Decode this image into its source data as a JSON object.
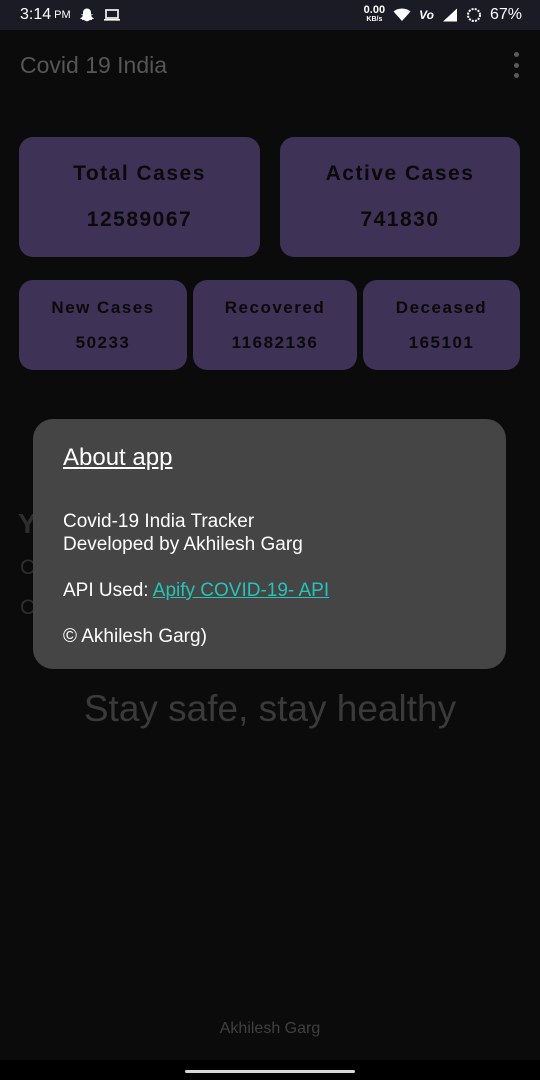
{
  "status_bar": {
    "time": "3:14",
    "ampm": "PM",
    "speed_value": "0.00",
    "speed_unit": "KB/s",
    "network_label": "Vo",
    "battery": "67%",
    "icons": [
      "snapchat-icon",
      "laptop-icon",
      "wifi-icon",
      "signal-icon",
      "battery-icon"
    ]
  },
  "app_bar": {
    "title": "Covid 19 India"
  },
  "stats": {
    "total": {
      "label": "Total Cases",
      "value": "12589067"
    },
    "active": {
      "label": "Active Cases",
      "value": "741830"
    },
    "new": {
      "label": "New Cases",
      "value": "50233"
    },
    "recovered": {
      "label": "Recovered",
      "value": "11682136"
    },
    "deceased": {
      "label": "Deceased",
      "value": "165101"
    }
  },
  "background_text": {
    "y": "Y",
    "c1": "C",
    "c2": "C"
  },
  "tagline": "Stay safe, stay healthy",
  "footer": {
    "name": "Akhilesh Garg"
  },
  "dialog": {
    "title": "About app",
    "line1": "Covid-19 India Tracker",
    "line2": "Developed by Akhilesh Garg",
    "api_prefix": "API Used: ",
    "api_link": "Apify COVID-19- API",
    "copyright": "© Akhilesh Garg)"
  },
  "colors": {
    "card": "#3f3257",
    "dialog": "#454545",
    "link": "#27c3b7",
    "background": "#0b0b0b"
  }
}
